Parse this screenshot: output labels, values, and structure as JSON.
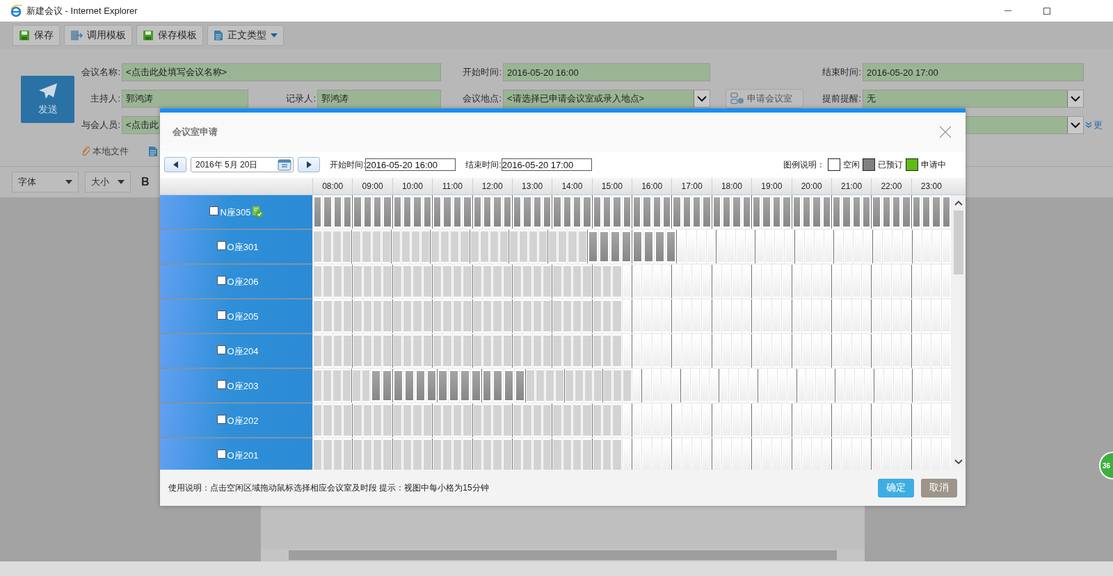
{
  "window": {
    "title": "新建会议 - Internet Explorer"
  },
  "toolbar": [
    {
      "label": "保存",
      "kind": "save",
      "dropdown": false
    },
    {
      "label": "调用模板",
      "kind": "template",
      "dropdown": false
    },
    {
      "label": "保存模板",
      "kind": "save",
      "dropdown": false
    },
    {
      "label": "正文类型",
      "kind": "doc",
      "dropdown": true
    }
  ],
  "send_button": {
    "label": "发送"
  },
  "form": {
    "meeting_name": {
      "label": "会议名称:",
      "value": "<点击此处填写会议名称>",
      "kind": "text"
    },
    "start_time": {
      "label": "开始时间:",
      "value": "2016-05-20 16:00",
      "kind": "text"
    },
    "end_time": {
      "label": "结束时间:",
      "value": "2016-05-20 17:00",
      "kind": "text"
    },
    "host": {
      "label": "主持人:",
      "value": "郭鸿涛",
      "kind": "text"
    },
    "recorder": {
      "label": "记录人:",
      "value": "郭鸿涛",
      "kind": "text"
    },
    "location": {
      "label": "会议地点:",
      "value": "<请选择已申请会议室或录入地点>",
      "kind": "select"
    },
    "apply_room_button": {
      "label": "申请会议室"
    },
    "reminder": {
      "label": "提前提醒:",
      "value": "无",
      "kind": "select"
    },
    "attendees": {
      "label": "与会人员:",
      "value": "<点击此",
      "kind": "text"
    },
    "row_3_select": {
      "kind": "select"
    },
    "more_link": {
      "label": "更"
    },
    "attachments": [
      {
        "label": "本地文件"
      }
    ]
  },
  "editor_toolbar": {
    "font_select": "字体",
    "size_select": "大小",
    "bold_button": "B"
  },
  "side_badge": "36",
  "dialog": {
    "title": "会议室申请",
    "date": "2016年 5月 20日",
    "start_label": "开始时间:",
    "start_value": "2016-05-20 16:00",
    "end_label": "结束时间:",
    "end_value": "2016-05-20 17:00",
    "legend": {
      "label": "图例说明：",
      "items": [
        {
          "label": "空闲",
          "color": "#ffffff"
        },
        {
          "label": "已预订",
          "color": "#808080"
        },
        {
          "label": "申请中",
          "color": "#5cbd14"
        }
      ]
    },
    "hours": [
      "08:00",
      "09:00",
      "10:00",
      "11:00",
      "12:00",
      "13:00",
      "14:00",
      "15:00",
      "16:00",
      "17:00",
      "18:00",
      "19:00",
      "20:00",
      "21:00",
      "22:00",
      "23:00"
    ],
    "elapsed": [
      [
        true,
        true,
        true,
        true
      ],
      [
        true,
        true,
        true,
        true
      ],
      [
        true,
        true,
        true,
        true
      ],
      [
        true,
        true,
        true,
        true
      ],
      [
        true,
        true,
        true,
        true
      ],
      [
        true,
        true,
        true,
        true
      ],
      [
        true,
        true,
        true,
        true
      ],
      [
        true,
        true,
        true,
        false
      ],
      [
        false,
        false,
        false,
        false
      ],
      [
        false,
        false,
        false,
        false
      ],
      [
        false,
        false,
        false,
        false
      ],
      [
        false,
        false,
        false,
        false
      ],
      [
        false,
        false,
        false,
        false
      ],
      [
        false,
        false,
        false,
        false
      ],
      [
        false,
        false,
        false,
        false
      ],
      [
        false,
        false,
        false,
        false
      ]
    ],
    "rooms": [
      {
        "name": "N座305",
        "checked": false,
        "approved": true,
        "booked": [
          [
            true,
            true,
            true,
            true
          ],
          [
            true,
            true,
            true,
            true
          ],
          [
            true,
            true,
            true,
            true
          ],
          [
            true,
            true,
            true,
            true
          ],
          [
            true,
            true,
            true,
            true
          ],
          [
            true,
            true,
            true,
            true
          ],
          [
            true,
            true,
            true,
            true
          ],
          [
            true,
            true,
            true,
            true
          ],
          [
            true,
            true,
            true,
            true
          ],
          [
            true,
            true,
            true,
            true
          ],
          [
            true,
            true,
            true,
            true
          ],
          [
            true,
            true,
            true,
            true
          ],
          [
            true,
            true,
            true,
            true
          ],
          [
            true,
            true,
            true,
            true
          ],
          [
            true,
            true,
            true,
            true
          ],
          [
            true,
            true,
            true,
            true
          ]
        ]
      },
      {
        "name": "O座301",
        "checked": false,
        "approved": false,
        "booked": [
          [
            false,
            false,
            false,
            false
          ],
          [
            false,
            false,
            false,
            false
          ],
          [
            false,
            false,
            false,
            false
          ],
          [
            false,
            false,
            false,
            false
          ],
          [
            false,
            false,
            false,
            false
          ],
          [
            false,
            false,
            false,
            false
          ],
          [
            false,
            false,
            false,
            false
          ],
          [
            true,
            true,
            true,
            true
          ],
          [
            true,
            true,
            true,
            true
          ],
          [
            false,
            false,
            false,
            false
          ],
          [
            false,
            false,
            false,
            false
          ],
          [
            false,
            false,
            false,
            false
          ],
          [
            false,
            false,
            false,
            false
          ],
          [
            false,
            false,
            false,
            false
          ],
          [
            false,
            false,
            false,
            false
          ],
          [
            false,
            false,
            false,
            false
          ]
        ]
      },
      {
        "name": "O座206",
        "checked": false,
        "approved": false,
        "booked": [
          [
            false,
            false,
            false,
            false
          ],
          [
            false,
            false,
            false,
            false
          ],
          [
            false,
            false,
            false,
            false
          ],
          [
            false,
            false,
            false,
            false
          ],
          [
            false,
            false,
            false,
            false
          ],
          [
            false,
            false,
            false,
            false
          ],
          [
            false,
            false,
            false,
            false
          ],
          [
            false,
            false,
            false,
            false
          ],
          [
            false,
            false,
            false,
            false
          ],
          [
            false,
            false,
            false,
            false
          ],
          [
            false,
            false,
            false,
            false
          ],
          [
            false,
            false,
            false,
            false
          ],
          [
            false,
            false,
            false,
            false
          ],
          [
            false,
            false,
            false,
            false
          ],
          [
            false,
            false,
            false,
            false
          ],
          [
            false,
            false,
            false,
            false
          ]
        ]
      },
      {
        "name": "O座205",
        "checked": false,
        "approved": false,
        "booked": [
          [
            false,
            false,
            false,
            false
          ],
          [
            false,
            false,
            false,
            false
          ],
          [
            false,
            false,
            false,
            false
          ],
          [
            false,
            false,
            false,
            false
          ],
          [
            false,
            false,
            false,
            false
          ],
          [
            false,
            false,
            false,
            false
          ],
          [
            false,
            false,
            false,
            false
          ],
          [
            false,
            false,
            false,
            false
          ],
          [
            false,
            false,
            false,
            false
          ],
          [
            false,
            false,
            false,
            false
          ],
          [
            false,
            false,
            false,
            false
          ],
          [
            false,
            false,
            false,
            false
          ],
          [
            false,
            false,
            false,
            false
          ],
          [
            false,
            false,
            false,
            false
          ],
          [
            false,
            false,
            false,
            false
          ],
          [
            false,
            false,
            false,
            false
          ]
        ]
      },
      {
        "name": "O座204",
        "checked": false,
        "approved": false,
        "booked": [
          [
            false,
            false,
            false,
            false
          ],
          [
            false,
            false,
            false,
            false
          ],
          [
            false,
            false,
            false,
            false
          ],
          [
            false,
            false,
            false,
            false
          ],
          [
            false,
            false,
            false,
            false
          ],
          [
            false,
            false,
            false,
            false
          ],
          [
            false,
            false,
            false,
            false
          ],
          [
            false,
            false,
            false,
            false
          ],
          [
            false,
            false,
            false,
            false
          ],
          [
            false,
            false,
            false,
            false
          ],
          [
            false,
            false,
            false,
            false
          ],
          [
            false,
            false,
            false,
            false
          ],
          [
            false,
            false,
            false,
            false
          ],
          [
            false,
            false,
            false,
            false
          ],
          [
            false,
            false,
            false,
            false
          ],
          [
            false,
            false,
            false,
            false
          ]
        ]
      },
      {
        "name": "O座203",
        "checked": false,
        "approved": false,
        "booked": [
          [
            false,
            false,
            false,
            false
          ],
          [
            false,
            false,
            true,
            true
          ],
          [
            true,
            true,
            true,
            true
          ],
          [
            true,
            true,
            true,
            true
          ],
          [
            true,
            true,
            true,
            true
          ],
          [
            false,
            false,
            false,
            false
          ],
          [
            false,
            false,
            false,
            false
          ],
          [
            false,
            false,
            false,
            false
          ],
          [
            false,
            false,
            false,
            false
          ],
          [
            false,
            false,
            false,
            false
          ],
          [
            false,
            false,
            false,
            false
          ],
          [
            false,
            false,
            false,
            false
          ],
          [
            false,
            false,
            false,
            false
          ],
          [
            false,
            false,
            false,
            false
          ],
          [
            false,
            false,
            false,
            false
          ],
          [
            false,
            false,
            false,
            false
          ]
        ]
      },
      {
        "name": "O座202",
        "checked": false,
        "approved": false,
        "booked": [
          [
            false,
            false,
            false,
            false
          ],
          [
            false,
            false,
            false,
            false
          ],
          [
            false,
            false,
            false,
            false
          ],
          [
            false,
            false,
            false,
            false
          ],
          [
            false,
            false,
            false,
            false
          ],
          [
            false,
            false,
            false,
            false
          ],
          [
            false,
            false,
            false,
            false
          ],
          [
            false,
            false,
            false,
            false
          ],
          [
            false,
            false,
            false,
            false
          ],
          [
            false,
            false,
            false,
            false
          ],
          [
            false,
            false,
            false,
            false
          ],
          [
            false,
            false,
            false,
            false
          ],
          [
            false,
            false,
            false,
            false
          ],
          [
            false,
            false,
            false,
            false
          ],
          [
            false,
            false,
            false,
            false
          ],
          [
            false,
            false,
            false,
            false
          ]
        ]
      },
      {
        "name": "O座201",
        "checked": false,
        "approved": false,
        "booked": [
          [
            false,
            false,
            false,
            false
          ],
          [
            false,
            false,
            false,
            false
          ],
          [
            false,
            false,
            false,
            false
          ],
          [
            false,
            false,
            false,
            false
          ],
          [
            false,
            false,
            false,
            false
          ],
          [
            false,
            false,
            false,
            false
          ],
          [
            false,
            false,
            false,
            false
          ],
          [
            false,
            false,
            false,
            false
          ],
          [
            false,
            false,
            false,
            false
          ],
          [
            false,
            false,
            false,
            false
          ],
          [
            false,
            false,
            false,
            false
          ],
          [
            false,
            false,
            false,
            false
          ],
          [
            false,
            false,
            false,
            false
          ],
          [
            false,
            false,
            false,
            false
          ],
          [
            false,
            false,
            false,
            false
          ],
          [
            false,
            false,
            false,
            false
          ]
        ]
      }
    ],
    "footer_note": "使用说明：点击空闲区域拖动鼠标选择相应会议室及时段 提示：视图中每小格为15分钟",
    "ok_button": "确定",
    "cancel_button": "取消"
  }
}
